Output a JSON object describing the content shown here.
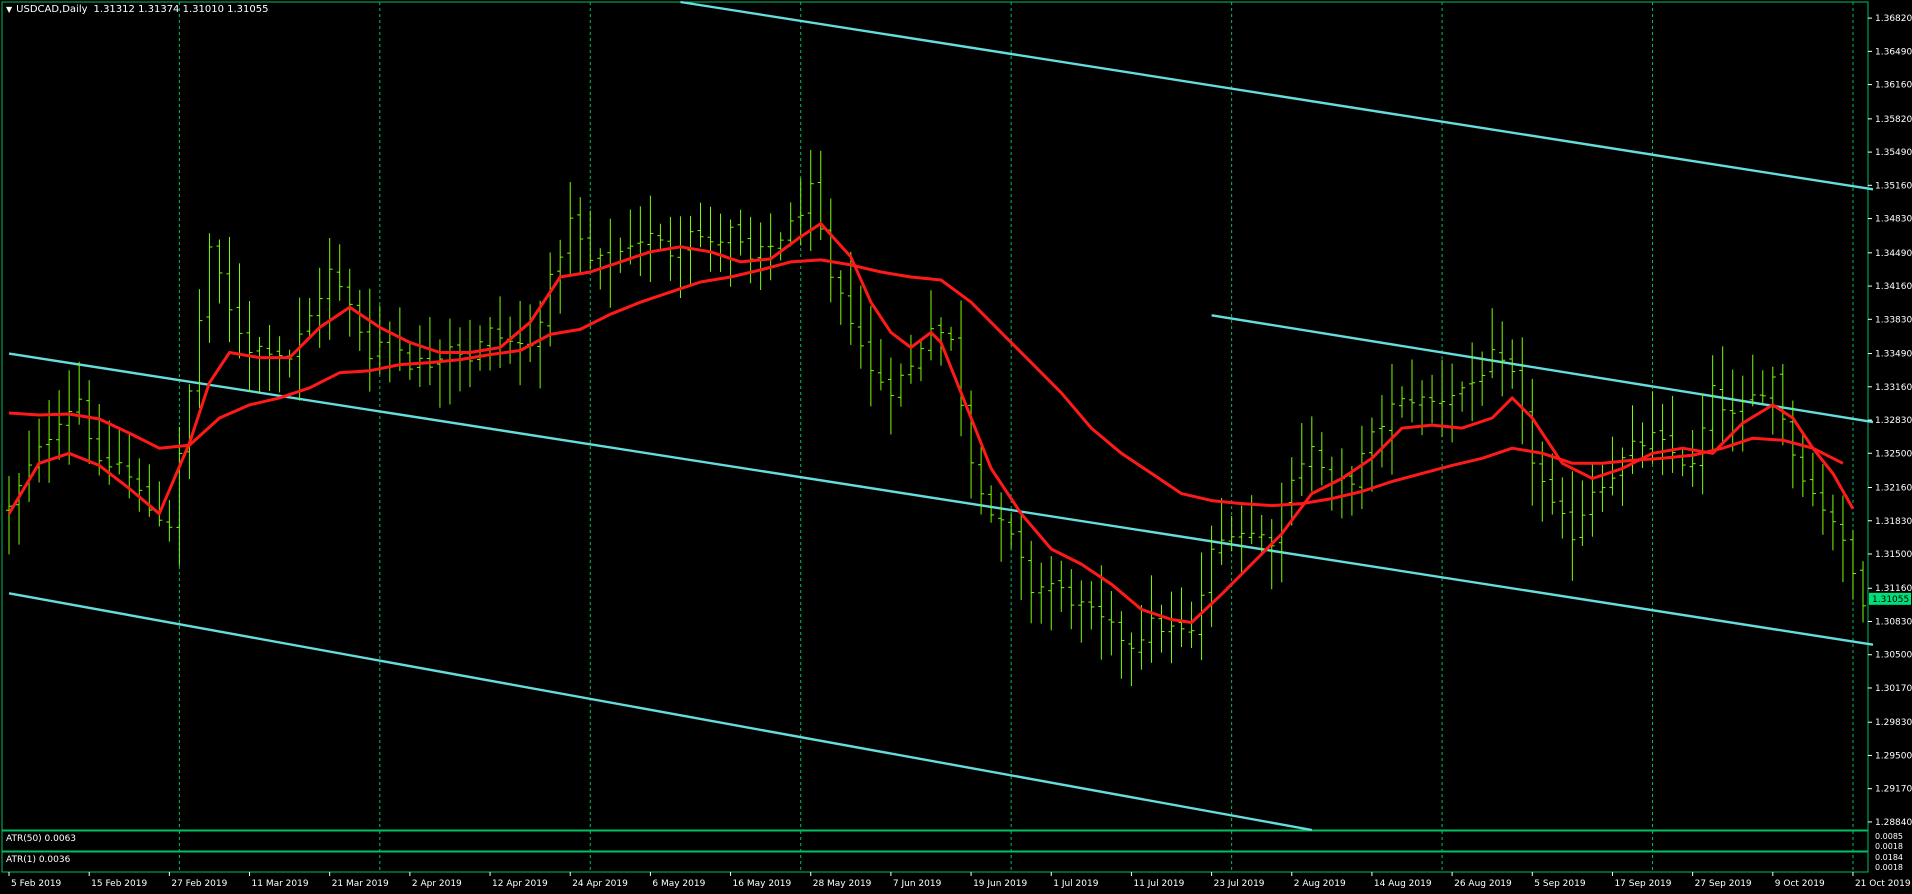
{
  "header": {
    "symbol": "USDCAD,Daily",
    "ohlc": "1.31312 1.31374 1.31010 1.31055"
  },
  "indicators": {
    "atr50_label": "ATR(50) 0.0063",
    "atr1_label": "ATR(1) 0.0036",
    "atr50_scale": [
      "0.0085",
      "0.0018"
    ],
    "atr1_scale": [
      "0.0184",
      "0.0018"
    ]
  },
  "colors": {
    "background": "#000000",
    "frame": "#00c060",
    "grid": "#00c060",
    "bars": "#7cfc00",
    "ma": "#ff1a1a",
    "channel": "#66dddd",
    "axis_text": "#ffffff",
    "price_tag_bg": "#00e07a"
  },
  "chart_data": {
    "type": "bar",
    "title": "USDCAD,Daily",
    "current_price": 1.31055,
    "current_price_label": "1.31055",
    "ylim": [
      1.2876,
      1.3698
    ],
    "y_ticks": [
      1.3682,
      1.3649,
      1.3616,
      1.3582,
      1.3549,
      1.3516,
      1.3483,
      1.3449,
      1.3416,
      1.3383,
      1.3349,
      1.3316,
      1.3283,
      1.325,
      1.3216,
      1.3183,
      1.315,
      1.3116,
      1.3083,
      1.305,
      1.3017,
      1.2983,
      1.295,
      1.2917,
      1.2884
    ],
    "y_tick_labels": [
      "1.36820",
      "1.36490",
      "1.36160",
      "1.35820",
      "1.35490",
      "1.35160",
      "1.34830",
      "1.34490",
      "1.34160",
      "1.33830",
      "1.33490",
      "1.33160",
      "1.32830",
      "1.32500",
      "1.32160",
      "1.31830",
      "1.31500",
      "1.31160",
      "1.30830",
      "1.30500",
      "1.30170",
      "1.29830",
      "1.29500",
      "1.29170",
      "1.28840"
    ],
    "x_labels": [
      "5 Feb 2019",
      "15 Feb 2019",
      "27 Feb 2019",
      "11 Mar 2019",
      "21 Mar 2019",
      "2 Apr 2019",
      "12 Apr 2019",
      "24 Apr 2019",
      "6 May 2019",
      "16 May 2019",
      "28 May 2019",
      "7 Jun 2019",
      "19 Jun 2019",
      "1 Jul 2019",
      "11 Jul 2019",
      "23 Jul 2019",
      "2 Aug 2019",
      "14 Aug 2019",
      "26 Aug 2019",
      "5 Sep 2019",
      "17 Sep 2019",
      "27 Sep 2019",
      "9 Oct 2019",
      "21 Oct 2019"
    ],
    "x_label_bars": [
      0,
      8,
      16,
      24,
      32,
      40,
      48,
      56,
      64,
      72,
      80,
      88,
      96,
      104,
      112,
      120,
      128,
      136,
      144,
      152,
      160,
      168,
      176,
      184
    ],
    "vgrid_bars": [
      17,
      37,
      58,
      79,
      100,
      122,
      143,
      164,
      184,
      205
    ],
    "bars_count": 186,
    "price_path": [
      [
        0,
        1.3195
      ],
      [
        2,
        1.3235
      ],
      [
        5,
        1.3285
      ],
      [
        7,
        1.3305
      ],
      [
        9,
        1.3235
      ],
      [
        11,
        1.324
      ],
      [
        14,
        1.3195
      ],
      [
        16,
        1.318
      ],
      [
        18,
        1.331
      ],
      [
        20,
        1.3455
      ],
      [
        22,
        1.339
      ],
      [
        24,
        1.3355
      ],
      [
        26,
        1.3355
      ],
      [
        28,
        1.3345
      ],
      [
        30,
        1.3385
      ],
      [
        32,
        1.343
      ],
      [
        34,
        1.3395
      ],
      [
        36,
        1.335
      ],
      [
        38,
        1.337
      ],
      [
        40,
        1.334
      ],
      [
        42,
        1.334
      ],
      [
        44,
        1.336
      ],
      [
        46,
        1.3345
      ],
      [
        48,
        1.337
      ],
      [
        50,
        1.336
      ],
      [
        52,
        1.3355
      ],
      [
        54,
        1.342
      ],
      [
        56,
        1.348
      ],
      [
        58,
        1.344
      ],
      [
        60,
        1.344
      ],
      [
        62,
        1.346
      ],
      [
        64,
        1.3465
      ],
      [
        66,
        1.345
      ],
      [
        68,
        1.3475
      ],
      [
        70,
        1.3455
      ],
      [
        72,
        1.347
      ],
      [
        74,
        1.344
      ],
      [
        76,
        1.3455
      ],
      [
        78,
        1.3475
      ],
      [
        80,
        1.351
      ],
      [
        82,
        1.342
      ],
      [
        84,
        1.3385
      ],
      [
        86,
        1.333
      ],
      [
        88,
        1.3315
      ],
      [
        90,
        1.3335
      ],
      [
        92,
        1.338
      ],
      [
        94,
        1.336
      ],
      [
        96,
        1.3245
      ],
      [
        98,
        1.319
      ],
      [
        100,
        1.3165
      ],
      [
        102,
        1.3115
      ],
      [
        104,
        1.312
      ],
      [
        106,
        1.3105
      ],
      [
        108,
        1.309
      ],
      [
        110,
        1.3075
      ],
      [
        112,
        1.306
      ],
      [
        114,
        1.308
      ],
      [
        116,
        1.3075
      ],
      [
        118,
        1.307
      ],
      [
        120,
        1.315
      ],
      [
        122,
        1.3175
      ],
      [
        124,
        1.317
      ],
      [
        126,
        1.3165
      ],
      [
        128,
        1.323
      ],
      [
        130,
        1.3255
      ],
      [
        132,
        1.3215
      ],
      [
        134,
        1.3225
      ],
      [
        136,
        1.3265
      ],
      [
        138,
        1.3295
      ],
      [
        140,
        1.3305
      ],
      [
        142,
        1.33
      ],
      [
        144,
        1.331
      ],
      [
        146,
        1.332
      ],
      [
        148,
        1.3345
      ],
      [
        150,
        1.3325
      ],
      [
        152,
        1.3245
      ],
      [
        154,
        1.3195
      ],
      [
        156,
        1.317
      ],
      [
        158,
        1.3215
      ],
      [
        160,
        1.323
      ],
      [
        162,
        1.3255
      ],
      [
        164,
        1.3265
      ],
      [
        166,
        1.325
      ],
      [
        168,
        1.3235
      ],
      [
        170,
        1.331
      ],
      [
        172,
        1.3285
      ],
      [
        174,
        1.3305
      ],
      [
        176,
        1.3325
      ],
      [
        178,
        1.325
      ],
      [
        180,
        1.321
      ],
      [
        182,
        1.3185
      ],
      [
        184,
        1.313
      ],
      [
        185,
        1.3106
      ]
    ],
    "ma_fast": [
      [
        0,
        1.319
      ],
      [
        3,
        1.324
      ],
      [
        6,
        1.325
      ],
      [
        9,
        1.3238
      ],
      [
        12,
        1.3215
      ],
      [
        15,
        1.319
      ],
      [
        18,
        1.326
      ],
      [
        20,
        1.332
      ],
      [
        22,
        1.335
      ],
      [
        25,
        1.3345
      ],
      [
        28,
        1.3345
      ],
      [
        31,
        1.3375
      ],
      [
        34,
        1.3395
      ],
      [
        37,
        1.3375
      ],
      [
        40,
        1.336
      ],
      [
        43,
        1.335
      ],
      [
        46,
        1.335
      ],
      [
        49,
        1.3355
      ],
      [
        52,
        1.338
      ],
      [
        55,
        1.3425
      ],
      [
        58,
        1.343
      ],
      [
        61,
        1.344
      ],
      [
        64,
        1.345
      ],
      [
        67,
        1.3455
      ],
      [
        70,
        1.345
      ],
      [
        73,
        1.344
      ],
      [
        76,
        1.3443
      ],
      [
        79,
        1.3465
      ],
      [
        81,
        1.3478
      ],
      [
        84,
        1.3445
      ],
      [
        86,
        1.34
      ],
      [
        88,
        1.337
      ],
      [
        90,
        1.3355
      ],
      [
        92,
        1.337
      ],
      [
        93,
        1.336
      ],
      [
        95,
        1.331
      ],
      [
        98,
        1.3235
      ],
      [
        101,
        1.319
      ],
      [
        104,
        1.3155
      ],
      [
        107,
        1.314
      ],
      [
        110,
        1.312
      ],
      [
        113,
        1.3095
      ],
      [
        116,
        1.3085
      ],
      [
        118,
        1.3082
      ],
      [
        121,
        1.311
      ],
      [
        124,
        1.314
      ],
      [
        127,
        1.317
      ],
      [
        130,
        1.321
      ],
      [
        133,
        1.3225
      ],
      [
        136,
        1.3245
      ],
      [
        139,
        1.3275
      ],
      [
        142,
        1.3278
      ],
      [
        145,
        1.3275
      ],
      [
        148,
        1.3285
      ],
      [
        150,
        1.3305
      ],
      [
        152,
        1.3285
      ],
      [
        155,
        1.324
      ],
      [
        158,
        1.3225
      ],
      [
        161,
        1.3235
      ],
      [
        164,
        1.325
      ],
      [
        167,
        1.3255
      ],
      [
        170,
        1.325
      ],
      [
        173,
        1.328
      ],
      [
        176,
        1.3298
      ],
      [
        178,
        1.3285
      ],
      [
        180,
        1.3255
      ],
      [
        182,
        1.323
      ],
      [
        184,
        1.3195
      ]
    ],
    "ma_slow": [
      [
        0,
        1.329
      ],
      [
        3,
        1.3288
      ],
      [
        6,
        1.3289
      ],
      [
        9,
        1.3284
      ],
      [
        12,
        1.327
      ],
      [
        15,
        1.3255
      ],
      [
        18,
        1.3258
      ],
      [
        21,
        1.3285
      ],
      [
        24,
        1.3298
      ],
      [
        27,
        1.3305
      ],
      [
        30,
        1.3315
      ],
      [
        33,
        1.333
      ],
      [
        36,
        1.3332
      ],
      [
        39,
        1.3338
      ],
      [
        42,
        1.334
      ],
      [
        45,
        1.3343
      ],
      [
        48,
        1.3348
      ],
      [
        51,
        1.3352
      ],
      [
        54,
        1.3368
      ],
      [
        57,
        1.3373
      ],
      [
        60,
        1.3388
      ],
      [
        63,
        1.34
      ],
      [
        66,
        1.341
      ],
      [
        69,
        1.342
      ],
      [
        72,
        1.3425
      ],
      [
        75,
        1.3432
      ],
      [
        78,
        1.344
      ],
      [
        81,
        1.3442
      ],
      [
        84,
        1.3437
      ],
      [
        87,
        1.343
      ],
      [
        90,
        1.3425
      ],
      [
        93,
        1.3422
      ],
      [
        96,
        1.34
      ],
      [
        99,
        1.337
      ],
      [
        102,
        1.334
      ],
      [
        105,
        1.331
      ],
      [
        108,
        1.3275
      ],
      [
        111,
        1.325
      ],
      [
        114,
        1.323
      ],
      [
        117,
        1.321
      ],
      [
        120,
        1.3203
      ],
      [
        123,
        1.32
      ],
      [
        126,
        1.3198
      ],
      [
        129,
        1.32
      ],
      [
        132,
        1.3205
      ],
      [
        135,
        1.3212
      ],
      [
        138,
        1.3222
      ],
      [
        141,
        1.323
      ],
      [
        144,
        1.3238
      ],
      [
        147,
        1.3245
      ],
      [
        150,
        1.3255
      ],
      [
        153,
        1.325
      ],
      [
        156,
        1.324
      ],
      [
        159,
        1.324
      ],
      [
        162,
        1.3243
      ],
      [
        165,
        1.3245
      ],
      [
        168,
        1.3248
      ],
      [
        171,
        1.3255
      ],
      [
        174,
        1.3265
      ],
      [
        177,
        1.3263
      ],
      [
        180,
        1.3255
      ],
      [
        183,
        1.324
      ]
    ],
    "channels": [
      [
        [
          0,
          1.3349
        ],
        [
          186,
          1.306
        ]
      ],
      [
        [
          0,
          1.3111
        ],
        [
          130,
          1.2876
        ]
      ],
      [
        [
          67,
          1.3698
        ],
        [
          186,
          1.3512
        ]
      ],
      [
        [
          120,
          1.3387
        ],
        [
          186,
          1.3281
        ]
      ]
    ]
  }
}
